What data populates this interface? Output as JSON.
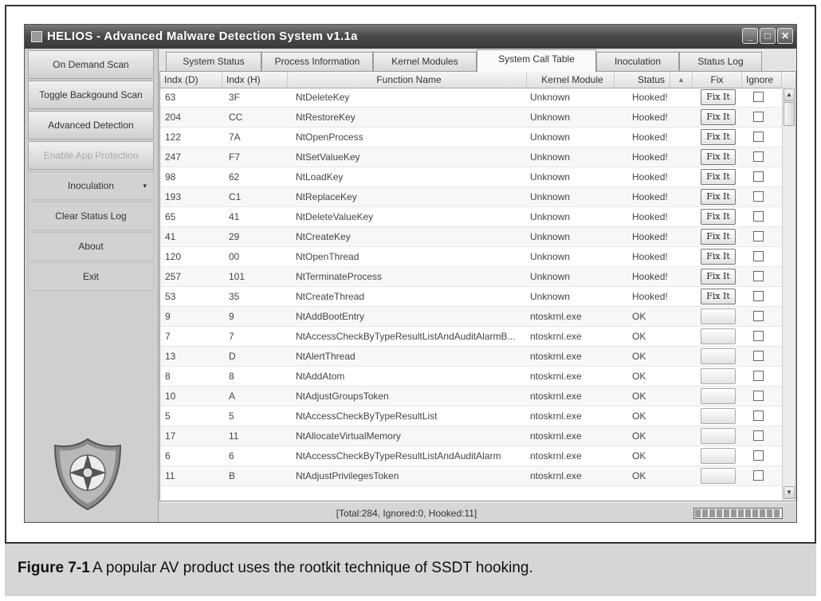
{
  "window": {
    "title": "HELIOS - Advanced Malware Detection System v1.1a",
    "minimize_glyph": "_",
    "maximize_glyph": "□",
    "close_glyph": "✕"
  },
  "sidebar": {
    "items": [
      {
        "label": "On Demand Scan",
        "enabled": true
      },
      {
        "label": "Toggle Backgound Scan",
        "enabled": true
      },
      {
        "label": "Advanced Detection",
        "enabled": true
      },
      {
        "label": "Enable App Protection",
        "enabled": false
      },
      {
        "label": "Inoculation",
        "enabled": true,
        "has_submenu": true
      },
      {
        "label": "Clear Status Log",
        "enabled": true
      },
      {
        "label": "About",
        "enabled": true
      },
      {
        "label": "Exit",
        "enabled": true
      }
    ],
    "submenu_caret": "▾",
    "logo_icon": "shield-cross-icon"
  },
  "tabs": [
    {
      "label": "System Status",
      "active": false
    },
    {
      "label": "Process Information",
      "active": false
    },
    {
      "label": "Kernel Modules",
      "active": false
    },
    {
      "label": "System Call Table",
      "active": true
    },
    {
      "label": "Inoculation",
      "active": false
    },
    {
      "label": "Status Log",
      "active": false
    }
  ],
  "table": {
    "columns": [
      "Indx (D)",
      "Indx (H)",
      "Function Name",
      "Kernel Module",
      "Status",
      "Fix",
      "Ignore"
    ],
    "sort_indicator": "▲",
    "fix_label": "Fix It",
    "rows": [
      {
        "d": "63",
        "h": "3F",
        "fn": "NtDeleteKey",
        "module": "Unknown",
        "status": "Hooked!",
        "fixable": true
      },
      {
        "d": "204",
        "h": "CC",
        "fn": "NtRestoreKey",
        "module": "Unknown",
        "status": "Hooked!",
        "fixable": true
      },
      {
        "d": "122",
        "h": "7A",
        "fn": "NtOpenProcess",
        "module": "Unknown",
        "status": "Hooked!",
        "fixable": true
      },
      {
        "d": "247",
        "h": "F7",
        "fn": "NtSetValueKey",
        "module": "Unknown",
        "status": "Hooked!",
        "fixable": true
      },
      {
        "d": "98",
        "h": "62",
        "fn": "NtLoadKey",
        "module": "Unknown",
        "status": "Hooked!",
        "fixable": true
      },
      {
        "d": "193",
        "h": "C1",
        "fn": "NtReplaceKey",
        "module": "Unknown",
        "status": "Hooked!",
        "fixable": true
      },
      {
        "d": "65",
        "h": "41",
        "fn": "NtDeleteValueKey",
        "module": "Unknown",
        "status": "Hooked!",
        "fixable": true
      },
      {
        "d": "41",
        "h": "29",
        "fn": "NtCreateKey",
        "module": "Unknown",
        "status": "Hooked!",
        "fixable": true
      },
      {
        "d": "120",
        "h": "00",
        "fn": "NtOpenThread",
        "module": "Unknown",
        "status": "Hooked!",
        "fixable": true
      },
      {
        "d": "257",
        "h": "101",
        "fn": "NtTerminateProcess",
        "module": "Unknown",
        "status": "Hooked!",
        "fixable": true
      },
      {
        "d": "53",
        "h": "35",
        "fn": "NtCreateThread",
        "module": "Unknown",
        "status": "Hooked!",
        "fixable": true
      },
      {
        "d": "9",
        "h": "9",
        "fn": "NtAddBootEntry",
        "module": "ntoskrnl.exe",
        "status": "OK",
        "fixable": false
      },
      {
        "d": "7",
        "h": "7",
        "fn": "NtAccessCheckByTypeResultListAndAuditAlarmB...",
        "module": "ntoskrnl.exe",
        "status": "OK",
        "fixable": false
      },
      {
        "d": "13",
        "h": "D",
        "fn": "NtAlertThread",
        "module": "ntoskrnl.exe",
        "status": "OK",
        "fixable": false
      },
      {
        "d": "8",
        "h": "8",
        "fn": "NtAddAtom",
        "module": "ntoskrnl.exe",
        "status": "OK",
        "fixable": false
      },
      {
        "d": "10",
        "h": "A",
        "fn": "NtAdjustGroupsToken",
        "module": "ntoskrnl.exe",
        "status": "OK",
        "fixable": false
      },
      {
        "d": "5",
        "h": "5",
        "fn": "NtAccessCheckByTypeResultList",
        "module": "ntoskrnl.exe",
        "status": "OK",
        "fixable": false
      },
      {
        "d": "17",
        "h": "11",
        "fn": "NtAllocateVirtualMemory",
        "module": "ntoskrnl.exe",
        "status": "OK",
        "fixable": false
      },
      {
        "d": "6",
        "h": "6",
        "fn": "NtAccessCheckByTypeResultListAndAuditAlarm",
        "module": "ntoskrnl.exe",
        "status": "OK",
        "fixable": false
      },
      {
        "d": "11",
        "h": "B",
        "fn": "NtAdjustPrivilegesToken",
        "module": "ntoskrnl.exe",
        "status": "OK",
        "fixable": false
      }
    ]
  },
  "statusbar": {
    "text": "[Total:284, Ignored:0, Hooked:11]",
    "progress": 1.0
  },
  "caption": {
    "figure": "Figure 7-1",
    "text": "A popular AV product uses the rootkit technique of SSDT hooking."
  }
}
